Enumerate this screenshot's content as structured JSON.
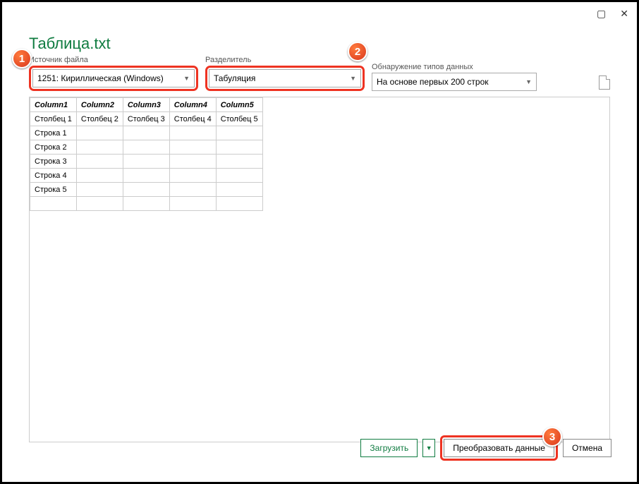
{
  "window": {
    "title": "Таблица.txt"
  },
  "labels": {
    "source": "Источник файла",
    "delimiter": "Разделитель",
    "detect": "Обнаружение типов данных"
  },
  "dropdowns": {
    "source": "1251: Кириллическая (Windows)",
    "delimiter": "Табуляция",
    "detect": "На основе первых 200 строк"
  },
  "table": {
    "headers": [
      "Column1",
      "Column2",
      "Column3",
      "Column4",
      "Column5"
    ],
    "rows": [
      [
        "Столбец 1",
        "Столбец 2",
        "Столбец 3",
        "Столбец 4",
        "Столбец 5"
      ],
      [
        "Строка 1",
        "",
        "",
        "",
        ""
      ],
      [
        "Строка 2",
        "",
        "",
        "",
        ""
      ],
      [
        "Строка 3",
        "",
        "",
        "",
        ""
      ],
      [
        "Строка 4",
        "",
        "",
        "",
        ""
      ],
      [
        "Строка 5",
        "",
        "",
        "",
        ""
      ],
      [
        "",
        "",
        "",
        "",
        ""
      ]
    ]
  },
  "buttons": {
    "load": "Загрузить",
    "transform": "Преобразовать данные",
    "cancel": "Отмена"
  },
  "badges": {
    "1": "1",
    "2": "2",
    "3": "3"
  }
}
